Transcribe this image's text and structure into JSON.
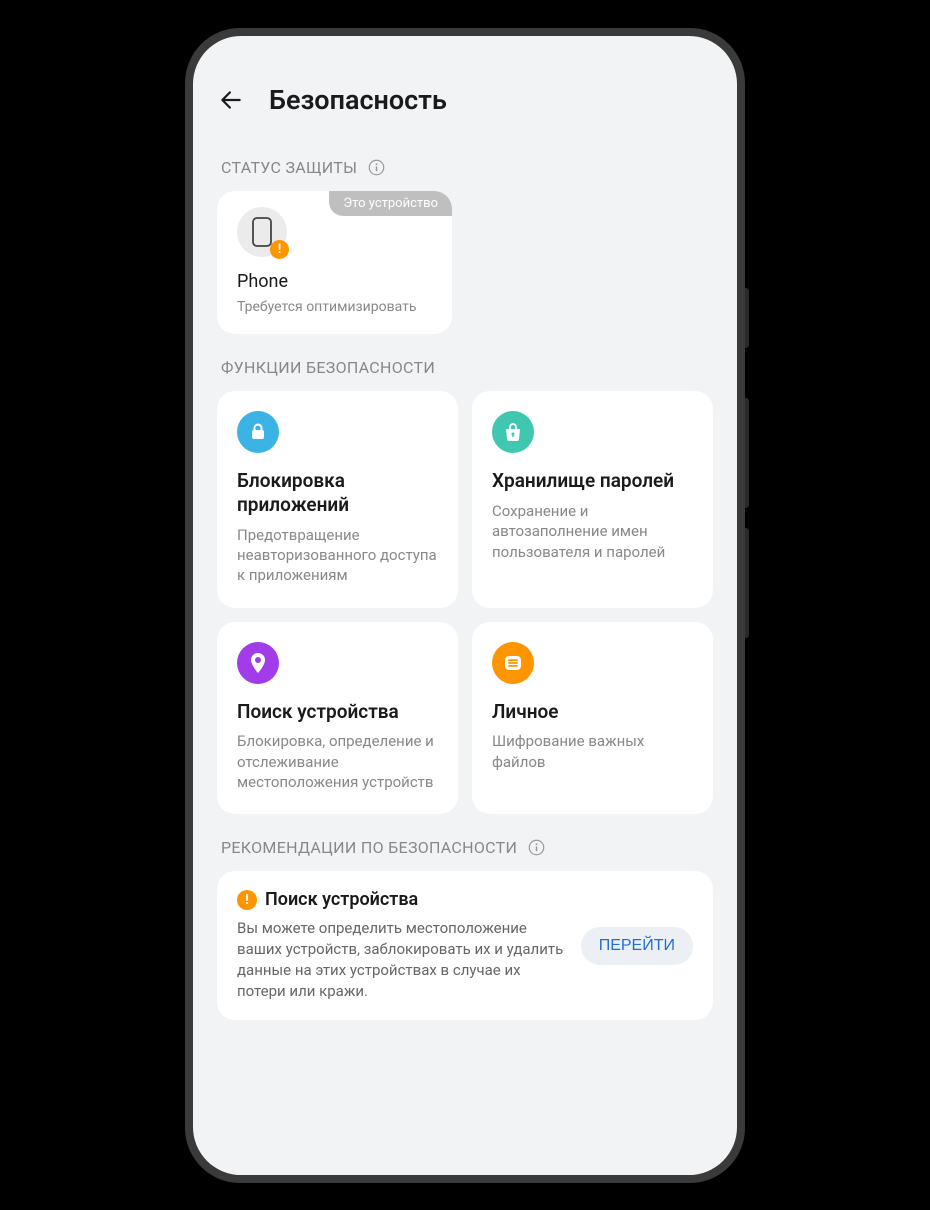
{
  "header": {
    "title": "Безопасность"
  },
  "sections": {
    "protection_status": {
      "label": "СТАТУС ЗАЩИТЫ",
      "device": {
        "badge": "Это устройство",
        "name": "Phone",
        "status": "Требуется оптимизировать"
      }
    },
    "security_functions": {
      "label": "ФУНКЦИИ БЕЗОПАСНОСТИ",
      "features": [
        {
          "title": "Блокировка приложений",
          "desc": "Предотвращение неавторизованного доступа к приложениям",
          "icon": "lock",
          "color": "#3bb4e5"
        },
        {
          "title": "Хранилище паролей",
          "desc": "Сохранение и автозаполнение имен пользователя и паролей",
          "icon": "bag-lock",
          "color": "#3fc7b0"
        },
        {
          "title": "Поиск устройства",
          "desc": "Блокировка, определение и отслеживание местоположения устройств",
          "icon": "pin",
          "color": "#a23be8"
        },
        {
          "title": "Личное",
          "desc": "Шифрование важных файлов",
          "icon": "stack",
          "color": "#ff9500"
        }
      ]
    },
    "recommendations": {
      "label": "РЕКОМЕНДАЦИИ ПО БЕЗОПАСНОСТИ",
      "item": {
        "title": "Поиск устройства",
        "desc": "Вы можете определить местоположение ваших устройств, заблокировать их и удалить данные на этих устройствах в случае их потери или кражи.",
        "button": "ПЕРЕЙТИ"
      }
    }
  }
}
